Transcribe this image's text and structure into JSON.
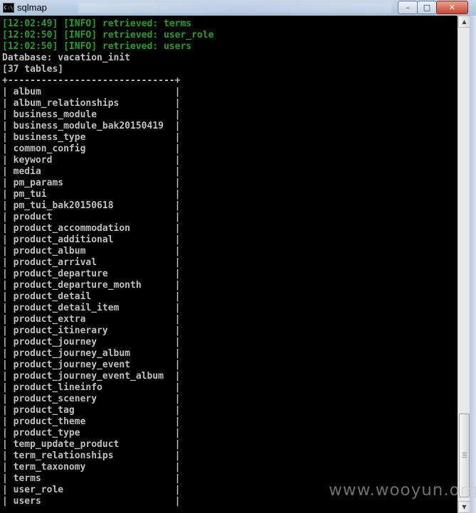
{
  "window": {
    "title": "sqlmap",
    "icon_label": "C:\\",
    "buttons": {
      "minimize": "–",
      "maximize": "□",
      "close": "✕"
    }
  },
  "console": {
    "info_lines": [
      "[12:02:49] [INFO] retrieved: terms",
      "[12:02:50] [INFO] retrieved: user_role",
      "[12:02:50] [INFO] retrieved: users"
    ],
    "database_line": "Database: vacation_init",
    "count_line": "[37 tables]",
    "border": "+------------------------------+",
    "tables": [
      "album",
      "album_relationships",
      "business_module",
      "business_module_bak20150419",
      "business_type",
      "common_config",
      "keyword",
      "media",
      "pm_params",
      "pm_tui",
      "pm_tui_bak20150618",
      "product",
      "product_accommodation",
      "product_additional",
      "product_album",
      "product_arrival",
      "product_departure",
      "product_departure_month",
      "product_detail",
      "product_detail_item",
      "product_extra",
      "product_itinerary",
      "product_journey",
      "product_journey_album",
      "product_journey_event",
      "product_journey_event_album",
      "product_lineinfo",
      "product_scenery",
      "product_tag",
      "product_theme",
      "product_type",
      "temp_update_product",
      "term_relationships",
      "term_taxonomy",
      "terms",
      "user_role",
      "users"
    ]
  },
  "scrollbar": {
    "up_arrow": "▲",
    "down_arrow": "▼"
  },
  "watermark": "www.wooyun.org",
  "colors": {
    "info_green": "#1fa31f",
    "text_gray": "#c0c0c0",
    "background": "#000000"
  }
}
